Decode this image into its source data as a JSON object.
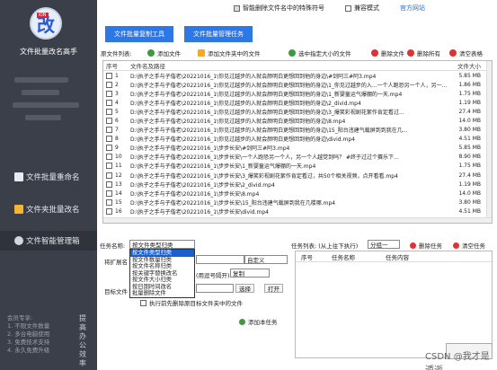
{
  "sidebar": {
    "logo_tag": "KIN",
    "logo_glyph": "改",
    "title": "文件批量改名高手",
    "nav": [
      {
        "label": "文件批量重命名"
      },
      {
        "label": "文件夹批量改名"
      },
      {
        "label": "文件智能管理箱"
      }
    ],
    "tips": [
      "会员专享:",
      "1. 不限文件数量",
      "2. 多台电脑使用",
      "3. 免费技术支持",
      "4. 永久免费升级"
    ],
    "side_text": "提高办公效率"
  },
  "topbar": {
    "smart_remove": "智能删除文件名中的特殊符号",
    "compat_mode": "兼容模式",
    "official_site": "官方网站"
  },
  "tabs": [
    "文件批量复制工具",
    "文件批量管理任务"
  ],
  "toolbar": {
    "list_label": "原文件列表:",
    "add_file": "添加文件",
    "add_folder": "添加文件夹中的文件",
    "select_size": "选中指定大小的文件",
    "delete_file": "删除文件",
    "delete_all": "删除所有",
    "clear_list": "清空表格"
  },
  "table": {
    "headers": [
      "序号",
      "文件名及路径",
      "文件大小"
    ],
    "rows": [
      {
        "no": "1",
        "path": "D:\\执子之手与子偕老\\20221016_1\\你见过越步的入就会颜明白更想回到他的身边\\#剑阿三#阿3.mp4",
        "size": "5.85 MB"
      },
      {
        "no": "2",
        "path": "D:\\执子之手与子偕老\\20221016_1\\你见过越步的入就会颜明白更想回到他的身边\\1_你见过越步的入...一个人跑恐另一个人，另一...",
        "size": "1.86 MB"
      },
      {
        "no": "3",
        "path": "D:\\执子之手与子偕老\\20221016_1\\你见过越步的入就会颜明白更想回到他的身边\\1_新婴童运气爆棚的一天.mp4",
        "size": "1.75 MB"
      },
      {
        "no": "4",
        "path": "D:\\执子之手与子偕老\\20221016_1\\你见过越步的入就会颜明白更想回到他的身边\\2_divid.mp4",
        "size": "1.19 MB"
      },
      {
        "no": "5",
        "path": "D:\\执子之手与子偕老\\20221016_1\\你见过越步的入就会颜明白更想回到他的身边\\3_爆笑彩视剧花絮作肯定看过...",
        "size": "27.4 MB"
      },
      {
        "no": "6",
        "path": "D:\\执子之手与子偕老\\20221016_1\\你见过越步的入就会颜明白更想回到他的身边\\8.mp4",
        "size": "14.0 MB"
      },
      {
        "no": "7",
        "path": "D:\\执子之手与子偕老\\20221016_1\\你见过越步的入就会颜明白更想回到他的身边\\15_阳台违建气载屏到到我在几...",
        "size": "3.80 MB"
      },
      {
        "no": "8",
        "path": "D:\\执子之手与子偕老\\20221016_1\\你见过越步的入就会颜明白更想回到他的身边\\divid.mp4",
        "size": "4.51 MB"
      },
      {
        "no": "9",
        "path": "D:\\执子之手与子偕老\\20221016_1\\步步长安\\#剑阿三#阿3.mp4",
        "size": "5.85 MB"
      },
      {
        "no": "10",
        "path": "D:\\执子之手与子偕老\\20221016_1\\步步长安\\一个人跑恐另一个人，另一个人越觉到吗？ #终于过过个赛乐下...",
        "size": "8.90 MB"
      },
      {
        "no": "11",
        "path": "D:\\执子之手与子偕老\\20221016_1\\步步长安\\1_新婴童运气爆棚的一天.mp4",
        "size": "1.75 MB"
      },
      {
        "no": "12",
        "path": "D:\\执子之手与子偕老\\20221016_1\\步步长安\\3_爆笑彩视剧花絮作肯定看过，共50个相关视频，点开看看.mp4",
        "size": "27.4 MB"
      },
      {
        "no": "13",
        "path": "D:\\执子之手与子偕老\\20221016_1\\步步长安\\2_divid.mp4",
        "size": "1.19 MB"
      },
      {
        "no": "14",
        "path": "D:\\执子之手与子偕老\\20221016_1\\步步长安\\8.mp4",
        "size": "14.0 MB"
      },
      {
        "no": "15",
        "path": "D:\\执子之手与子偕老\\20221016_1\\步步长安\\15_阳台违建气载屏到我在几楼哪.mp4",
        "size": "3.80 MB"
      },
      {
        "no": "16",
        "path": "D:\\执子之手与子偕老\\20221016_1\\步步长安\\divid.mp4",
        "size": "4.51 MB"
      }
    ]
  },
  "task": {
    "type_label": "任务名称:",
    "type_value": "按文件类型归类",
    "dropdown": [
      "按文件类型归类",
      "按文件数量归类",
      "按文件名称归类",
      "按关键字替换改名",
      "按文件大小归类",
      "按日期时间改名",
      "批量删除文件"
    ],
    "ext_label": "将扩展名",
    "custom": "自定义",
    "sep_hint": "(用逗号隔开)",
    "copy": "复制",
    "target_label": "目标文件",
    "choose": "选择",
    "open": "打开",
    "pre_delete": "执行前先删除原目标文件夹中的文件",
    "add_task": "添加本任务"
  },
  "task_list": {
    "label": "任务列表: (从上往下执行)",
    "mode": "分组一",
    "delete": "删除任务",
    "clear": "清空任务",
    "cols": [
      "序号",
      "任务名称",
      "任务内容"
    ]
  },
  "watermark": "CSDN @我才是遁逝"
}
